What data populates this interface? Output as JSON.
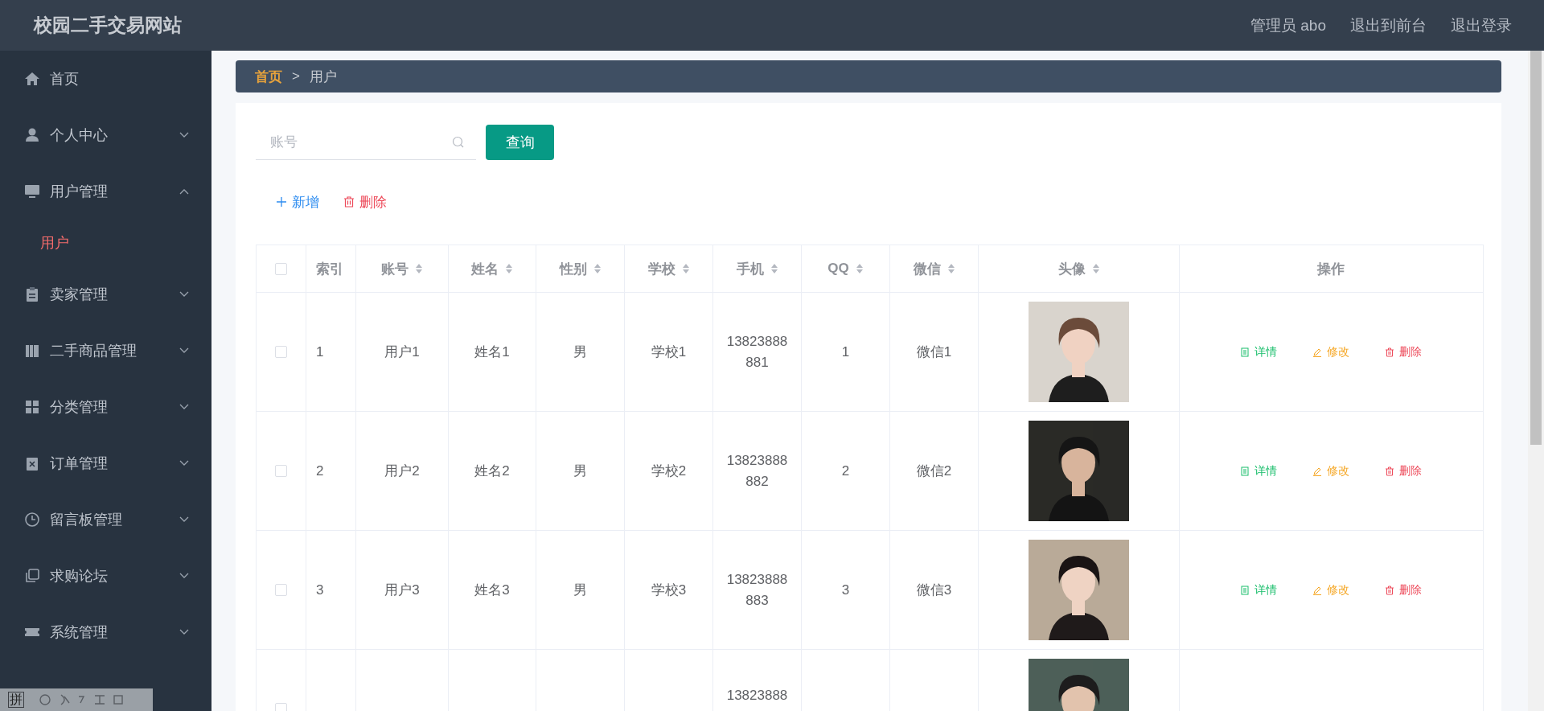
{
  "header": {
    "title": "校园二手交易网站",
    "links": [
      "管理员 abo",
      "退出到前台",
      "退出登录"
    ]
  },
  "sidebar": {
    "items": [
      {
        "label": "首页",
        "expandable": false
      },
      {
        "label": "个人中心",
        "expandable": true,
        "expanded": false
      },
      {
        "label": "用户管理",
        "expandable": true,
        "expanded": true,
        "children": [
          {
            "label": "用户",
            "selected": true
          }
        ]
      },
      {
        "label": "卖家管理",
        "expandable": true,
        "expanded": false
      },
      {
        "label": "二手商品管理",
        "expandable": true,
        "expanded": false
      },
      {
        "label": "分类管理",
        "expandable": true,
        "expanded": false
      },
      {
        "label": "订单管理",
        "expandable": true,
        "expanded": false
      },
      {
        "label": "留言板管理",
        "expandable": true,
        "expanded": false
      },
      {
        "label": "求购论坛",
        "expandable": true,
        "expanded": false
      },
      {
        "label": "系统管理",
        "expandable": true,
        "expanded": false
      }
    ]
  },
  "breadcrumb": {
    "items": [
      "首页",
      "用户"
    ],
    "separator": ">"
  },
  "search": {
    "placeholder": "账号",
    "button": "查询"
  },
  "actions": {
    "add": "新增",
    "delete": "删除"
  },
  "table": {
    "select_all": {
      "checked": false
    },
    "columns": [
      {
        "label": "索引",
        "sortable": false
      },
      {
        "label": "账号",
        "sortable": true
      },
      {
        "label": "姓名",
        "sortable": true
      },
      {
        "label": "性别",
        "sortable": true
      },
      {
        "label": "学校",
        "sortable": true
      },
      {
        "label": "手机",
        "sortable": true
      },
      {
        "label": "QQ",
        "sortable": true
      },
      {
        "label": "微信",
        "sortable": true
      },
      {
        "label": "头像",
        "sortable": true
      },
      {
        "label": "操作",
        "sortable": false
      }
    ],
    "rows": [
      {
        "checked": false,
        "cells": [
          "1",
          "用户1",
          "姓名1",
          "男",
          "学校1",
          "13823888881",
          "1",
          "微信1"
        ],
        "avatar": {
          "kind": "picture"
        },
        "actions": [
          "详情",
          "修改",
          "删除"
        ]
      },
      {
        "checked": false,
        "cells": [
          "2",
          "用户2",
          "姓名2",
          "男",
          "学校2",
          "13823888882",
          "2",
          "微信2"
        ],
        "avatar": {
          "kind": "picture"
        },
        "actions": [
          "详情",
          "修改",
          "删除"
        ]
      },
      {
        "checked": false,
        "cells": [
          "3",
          "用户3",
          "姓名3",
          "男",
          "学校3",
          "13823888883",
          "3",
          "微信3"
        ],
        "avatar": {
          "kind": "picture"
        },
        "actions": [
          "详情",
          "修改",
          "删除"
        ]
      },
      {
        "checked": false,
        "cells": [
          null,
          null,
          null,
          null,
          null,
          "13823888",
          null,
          null
        ],
        "avatar": {
          "kind": "picture"
        }
      }
    ]
  },
  "ime_toolbar": {
    "mode": "拼"
  }
}
